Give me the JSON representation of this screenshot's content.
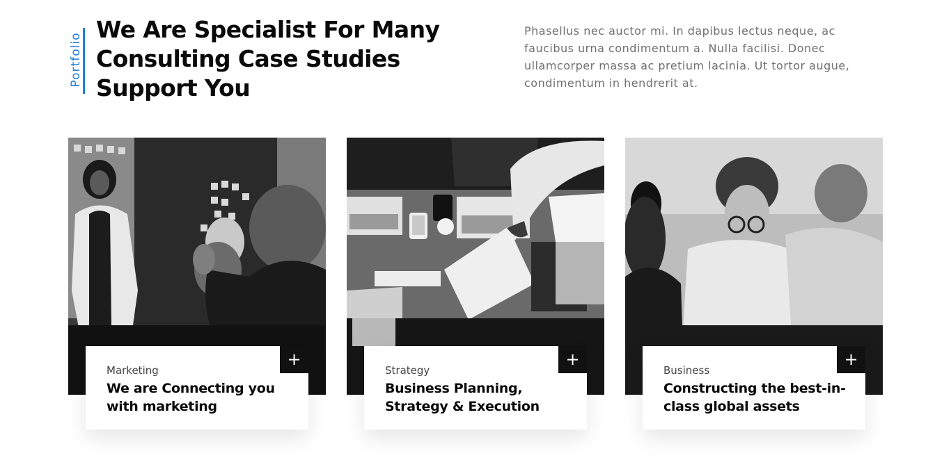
{
  "section": {
    "tag": "Portfolio",
    "headline": "We Are Specialist For Many Consulting Case Studies Support You",
    "intro": "Phasellus nec auctor mi. In dapibus lectus neque, ac faucibus urna condimentum a. Nulla facilisi. Donec ullamcorper massa ac pretium lacinia. Ut tortor augue, condimentum in hendrerit at."
  },
  "cards": [
    {
      "category": "Marketing",
      "title": "We are Connecting you with marketing",
      "action": "+"
    },
    {
      "category": "Strategy",
      "title": "Business Planning, Strategy & Execution",
      "action": "+"
    },
    {
      "category": "Business",
      "title": "Constructing the best-in-class global assets",
      "action": "+"
    }
  ],
  "colors": {
    "accent": "#1f7fd6",
    "heading": "#0a0a0a",
    "body_text": "#6f6f6f",
    "action_bg": "#111111"
  },
  "icons": {
    "card_action": "plus-icon"
  }
}
